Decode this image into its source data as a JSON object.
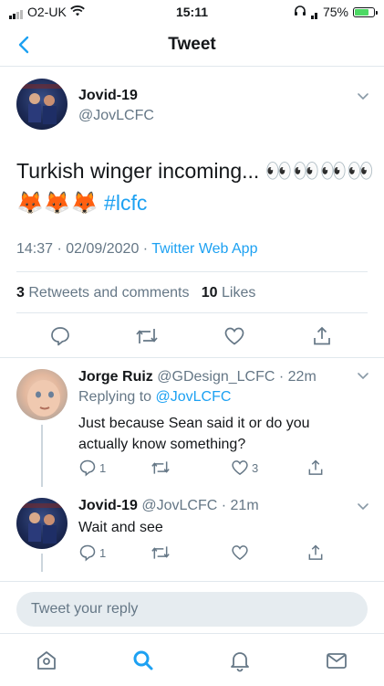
{
  "status": {
    "carrier": "O2-UK",
    "time": "15:11",
    "battery": "75%",
    "battery_level": 0.75
  },
  "header": {
    "title": "Tweet"
  },
  "main_tweet": {
    "name": "Jovid-19",
    "handle": "@JovLCFC",
    "text": "Turkish winger incoming...",
    "eyes": "👀👀👀👀",
    "foxes": "🦊🦊🦊",
    "hashtag": "#lcfc",
    "timestamp": "14:37 · 02/09/2020 · ",
    "source": "Twitter Web App",
    "retweets_count": "3",
    "retweets_label": "Retweets and comments",
    "likes_count": "10",
    "likes_label": "Likes"
  },
  "replies": [
    {
      "name": "Jorge Ruiz",
      "handle": "@GDesign_LCFC",
      "time": "· 22m",
      "replying_label": "Replying to",
      "replying_handle": "@JovLCFC",
      "text": "Just because Sean said it or do you actually know something?",
      "reply_count": "1",
      "like_count": "3"
    },
    {
      "name": "Jovid-19",
      "handle": "@JovLCFC",
      "time": "· 21m",
      "text": "Wait and see",
      "reply_count": "1"
    }
  ],
  "compose": {
    "placeholder": "Tweet your reply"
  },
  "icons": {
    "back": "chevron-left-icon",
    "comment": "comment-icon",
    "retweet": "retweet-icon",
    "like": "heart-icon",
    "share": "share-icon",
    "home": "home-icon",
    "search": "search-icon",
    "notifications": "bell-icon",
    "messages": "mail-icon"
  },
  "colors": {
    "accent": "#1da1f2",
    "text": "#14171a",
    "muted": "#657786",
    "border": "#e1e8ed"
  }
}
